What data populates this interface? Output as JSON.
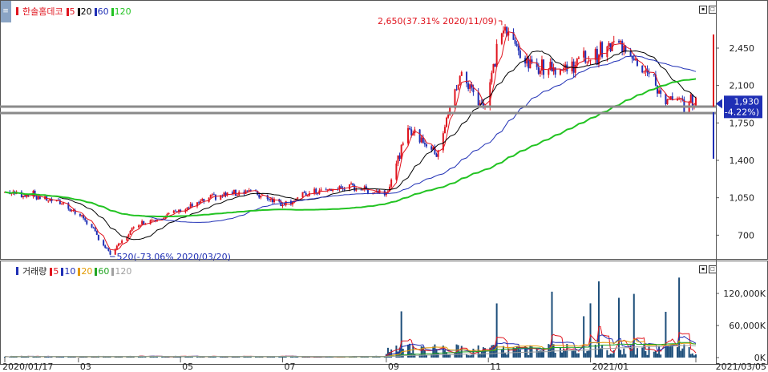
{
  "price_panel": {
    "legend": {
      "name": "한솔홈데코",
      "ma": [
        {
          "label": "5",
          "color": "#e0141e"
        },
        {
          "label": "20",
          "color": "#000000"
        },
        {
          "label": "60",
          "color": "#1f2fb5"
        },
        {
          "label": "120",
          "color": "#22c322"
        }
      ]
    },
    "y_ticks": [
      "2,450",
      "2,100",
      "1,750",
      "1,400",
      "1,050",
      "700"
    ],
    "current_price": "1,930",
    "current_change": "(-4.22%)",
    "high_annotation": "2,650(37.31% 2020/11/09)",
    "low_annotation": "520(-73.06% 2020/03/20)"
  },
  "volume_panel": {
    "legend": {
      "name": "거래량",
      "ma": [
        {
          "label": "5",
          "color": "#e0141e"
        },
        {
          "label": "10",
          "color": "#1f2fb5"
        },
        {
          "label": "20",
          "color": "#e39a00"
        },
        {
          "label": "60",
          "color": "#22a522"
        },
        {
          "label": "120",
          "color": "#a0a0a0"
        }
      ]
    },
    "y_ticks": [
      "120,000K",
      "60,000K",
      "0K"
    ]
  },
  "x_labels": [
    "2020/01/17",
    "03",
    "05",
    "07",
    "09",
    "11",
    "2021/01",
    "2021/03/05"
  ],
  "chart_data": {
    "type": "candlestick",
    "title": "한솔홈데코",
    "x_range": [
      "2020/01/17",
      "2021/03/05"
    ],
    "ylim": [
      500,
      2750
    ],
    "price_points": [
      {
        "date": "2020/01/17",
        "close": 1100
      },
      {
        "date": "2020/02/01",
        "close": 1080
      },
      {
        "date": "2020/02/20",
        "close": 1000
      },
      {
        "date": "2020/03/05",
        "close": 850
      },
      {
        "date": "2020/03/20",
        "close": 520
      },
      {
        "date": "2020/04/05",
        "close": 800
      },
      {
        "date": "2020/05/01",
        "close": 930
      },
      {
        "date": "2020/05/20",
        "close": 1050
      },
      {
        "date": "2020/06/10",
        "close": 1120
      },
      {
        "date": "2020/07/01",
        "close": 1000
      },
      {
        "date": "2020/07/20",
        "close": 1100
      },
      {
        "date": "2020/08/10",
        "close": 1150
      },
      {
        "date": "2020/09/01",
        "close": 1100
      },
      {
        "date": "2020/09/15",
        "close": 1700
      },
      {
        "date": "2020/10/01",
        "close": 1450
      },
      {
        "date": "2020/10/15",
        "close": 2200
      },
      {
        "date": "2020/10/30",
        "close": 1900
      },
      {
        "date": "2020/11/09",
        "close": 2650
      },
      {
        "date": "2020/11/25",
        "close": 2300
      },
      {
        "date": "2020/12/15",
        "close": 2250
      },
      {
        "date": "2021/01/05",
        "close": 2400
      },
      {
        "date": "2021/01/20",
        "close": 2500
      },
      {
        "date": "2021/02/05",
        "close": 2200
      },
      {
        "date": "2021/02/15",
        "close": 1950
      },
      {
        "date": "2021/03/05",
        "close": 1930
      }
    ],
    "high": {
      "value": 2650,
      "change_pct": 37.31,
      "date": "2020/11/09"
    },
    "low": {
      "value": 520,
      "change_pct": -73.06,
      "date": "2020/03/20"
    },
    "last": {
      "value": 1930,
      "change_pct": -4.22
    },
    "volume_ylim": [
      0,
      150000
    ]
  }
}
